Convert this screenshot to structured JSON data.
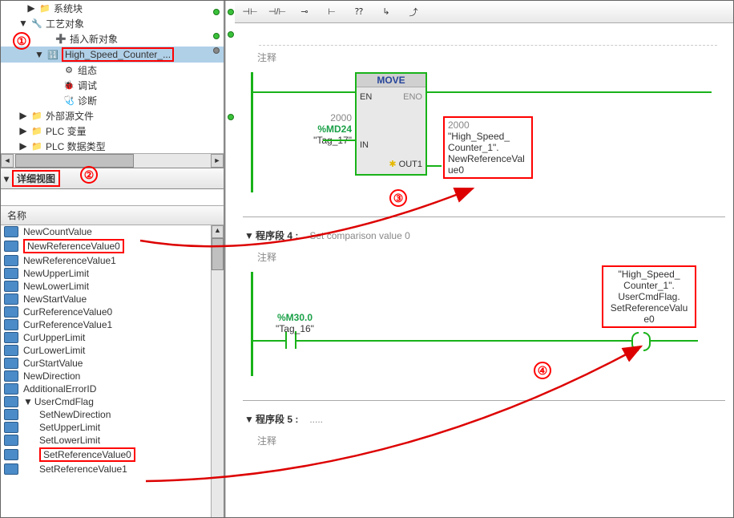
{
  "tree": {
    "items": [
      {
        "indent": 30,
        "toggle": "▶",
        "icon": "📁",
        "label": "系统块"
      },
      {
        "indent": 20,
        "toggle": "▼",
        "icon": "🔧",
        "label": "工艺对象"
      },
      {
        "indent": 50,
        "toggle": "",
        "icon": "➕",
        "label": "插入新对象"
      },
      {
        "indent": 40,
        "toggle": "▼",
        "icon": "🔢",
        "label": "High_Speed_Counter_...",
        "selected": true,
        "highlighted": true
      },
      {
        "indent": 60,
        "toggle": "",
        "icon": "⚙",
        "label": "组态"
      },
      {
        "indent": 60,
        "toggle": "",
        "icon": "🐞",
        "label": "调试"
      },
      {
        "indent": 60,
        "toggle": "",
        "icon": "🩺",
        "label": "诊断"
      },
      {
        "indent": 20,
        "toggle": "▶",
        "icon": "📁",
        "label": "外部源文件"
      },
      {
        "indent": 20,
        "toggle": "▶",
        "icon": "📁",
        "label": "PLC 变量"
      },
      {
        "indent": 20,
        "toggle": "▶",
        "icon": "📁",
        "label": "PLC 数据类型"
      }
    ]
  },
  "detail_header": "详细视图",
  "name_col": "名称",
  "detail_items": [
    {
      "indent": 0,
      "label": "NewCountValue"
    },
    {
      "indent": 0,
      "label": "NewReferenceValue0",
      "highlighted": true
    },
    {
      "indent": 0,
      "label": "NewReferenceValue1"
    },
    {
      "indent": 0,
      "label": "NewUpperLimit"
    },
    {
      "indent": 0,
      "label": "NewLowerLimit"
    },
    {
      "indent": 0,
      "label": "NewStartValue"
    },
    {
      "indent": 0,
      "label": "CurReferenceValue0"
    },
    {
      "indent": 0,
      "label": "CurReferenceValue1"
    },
    {
      "indent": 0,
      "label": "CurUpperLimit"
    },
    {
      "indent": 0,
      "label": "CurLowerLimit"
    },
    {
      "indent": 0,
      "label": "CurStartValue"
    },
    {
      "indent": 0,
      "label": "NewDirection"
    },
    {
      "indent": 0,
      "label": "AdditionalErrorID"
    },
    {
      "indent": 0,
      "label": "UserCmdFlag",
      "toggle": "▼"
    },
    {
      "indent": 20,
      "label": "SetNewDirection"
    },
    {
      "indent": 20,
      "label": "SetUpperLimit"
    },
    {
      "indent": 20,
      "label": "SetLowerLimit"
    },
    {
      "indent": 20,
      "label": "SetReferenceValue0",
      "highlighted": true
    },
    {
      "indent": 20,
      "label": "SetReferenceValue1"
    }
  ],
  "toolbar": {
    "btns": [
      "⊣⊢",
      "⊣/⊢",
      "⊸",
      "⊢",
      "⁇",
      "↳",
      "⤴"
    ]
  },
  "canvas": {
    "comment": "注释",
    "move": {
      "title": "MOVE",
      "en": "EN",
      "eno": "ENO",
      "in": "IN",
      "out": "OUT1",
      "in_value": "2000",
      "in_addr": "%MD24",
      "in_tag": "\"Tag_17\"",
      "out_value": "2000",
      "out_l1": "\"High_Speed_",
      "out_l2": "Counter_1\".",
      "out_l3": "NewReferenceVal",
      "out_l4": "ue0"
    },
    "seg4": {
      "title": "程序段 4 :",
      "subtitle": "Set comparison value 0",
      "comment": "注释",
      "contact_addr": "%M30.0",
      "contact_tag": "\"Tag_16\"",
      "coil_l1": "\"High_Speed_",
      "coil_l2": "Counter_1\".",
      "coil_l3": "UserCmdFlag.",
      "coil_l4": "SetReferenceValu",
      "coil_l5": "e0"
    },
    "seg5": {
      "title": "程序段 5 :",
      "subtitle": ".....",
      "comment": "注释"
    }
  },
  "markers": {
    "n1": "①",
    "n2": "②",
    "n3": "③",
    "n4": "④"
  }
}
